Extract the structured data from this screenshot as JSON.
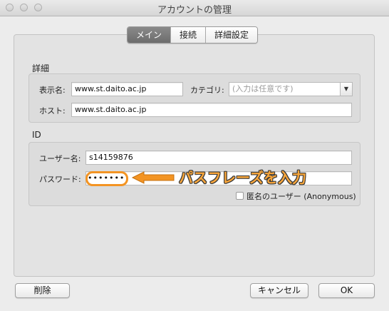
{
  "window": {
    "title": "アカウントの管理"
  },
  "tabs": [
    {
      "label": "メイン",
      "active": true
    },
    {
      "label": "接続",
      "active": false
    },
    {
      "label": "詳細設定",
      "active": false
    }
  ],
  "details": {
    "heading": "詳細",
    "display_name_label": "表示名:",
    "display_name_value": "www.st.daito.ac.jp",
    "category_label": "カテゴリ:",
    "category_placeholder": "(入力は任意です)",
    "host_label": "ホスト:",
    "host_value": "www.st.daito.ac.jp"
  },
  "id_section": {
    "heading": "ID",
    "username_label": "ユーザー名:",
    "username_value": "s14159876",
    "password_label": "パスワード:",
    "password_value": "•••••••",
    "anonymous_label": "匿名のユーザー (Anonymous)",
    "anonymous_checked": false
  },
  "annotation": {
    "text": "パスフレーズを入力",
    "color": "#f39423"
  },
  "buttons": {
    "delete": "削除",
    "cancel": "キャンセル",
    "ok": "OK"
  }
}
